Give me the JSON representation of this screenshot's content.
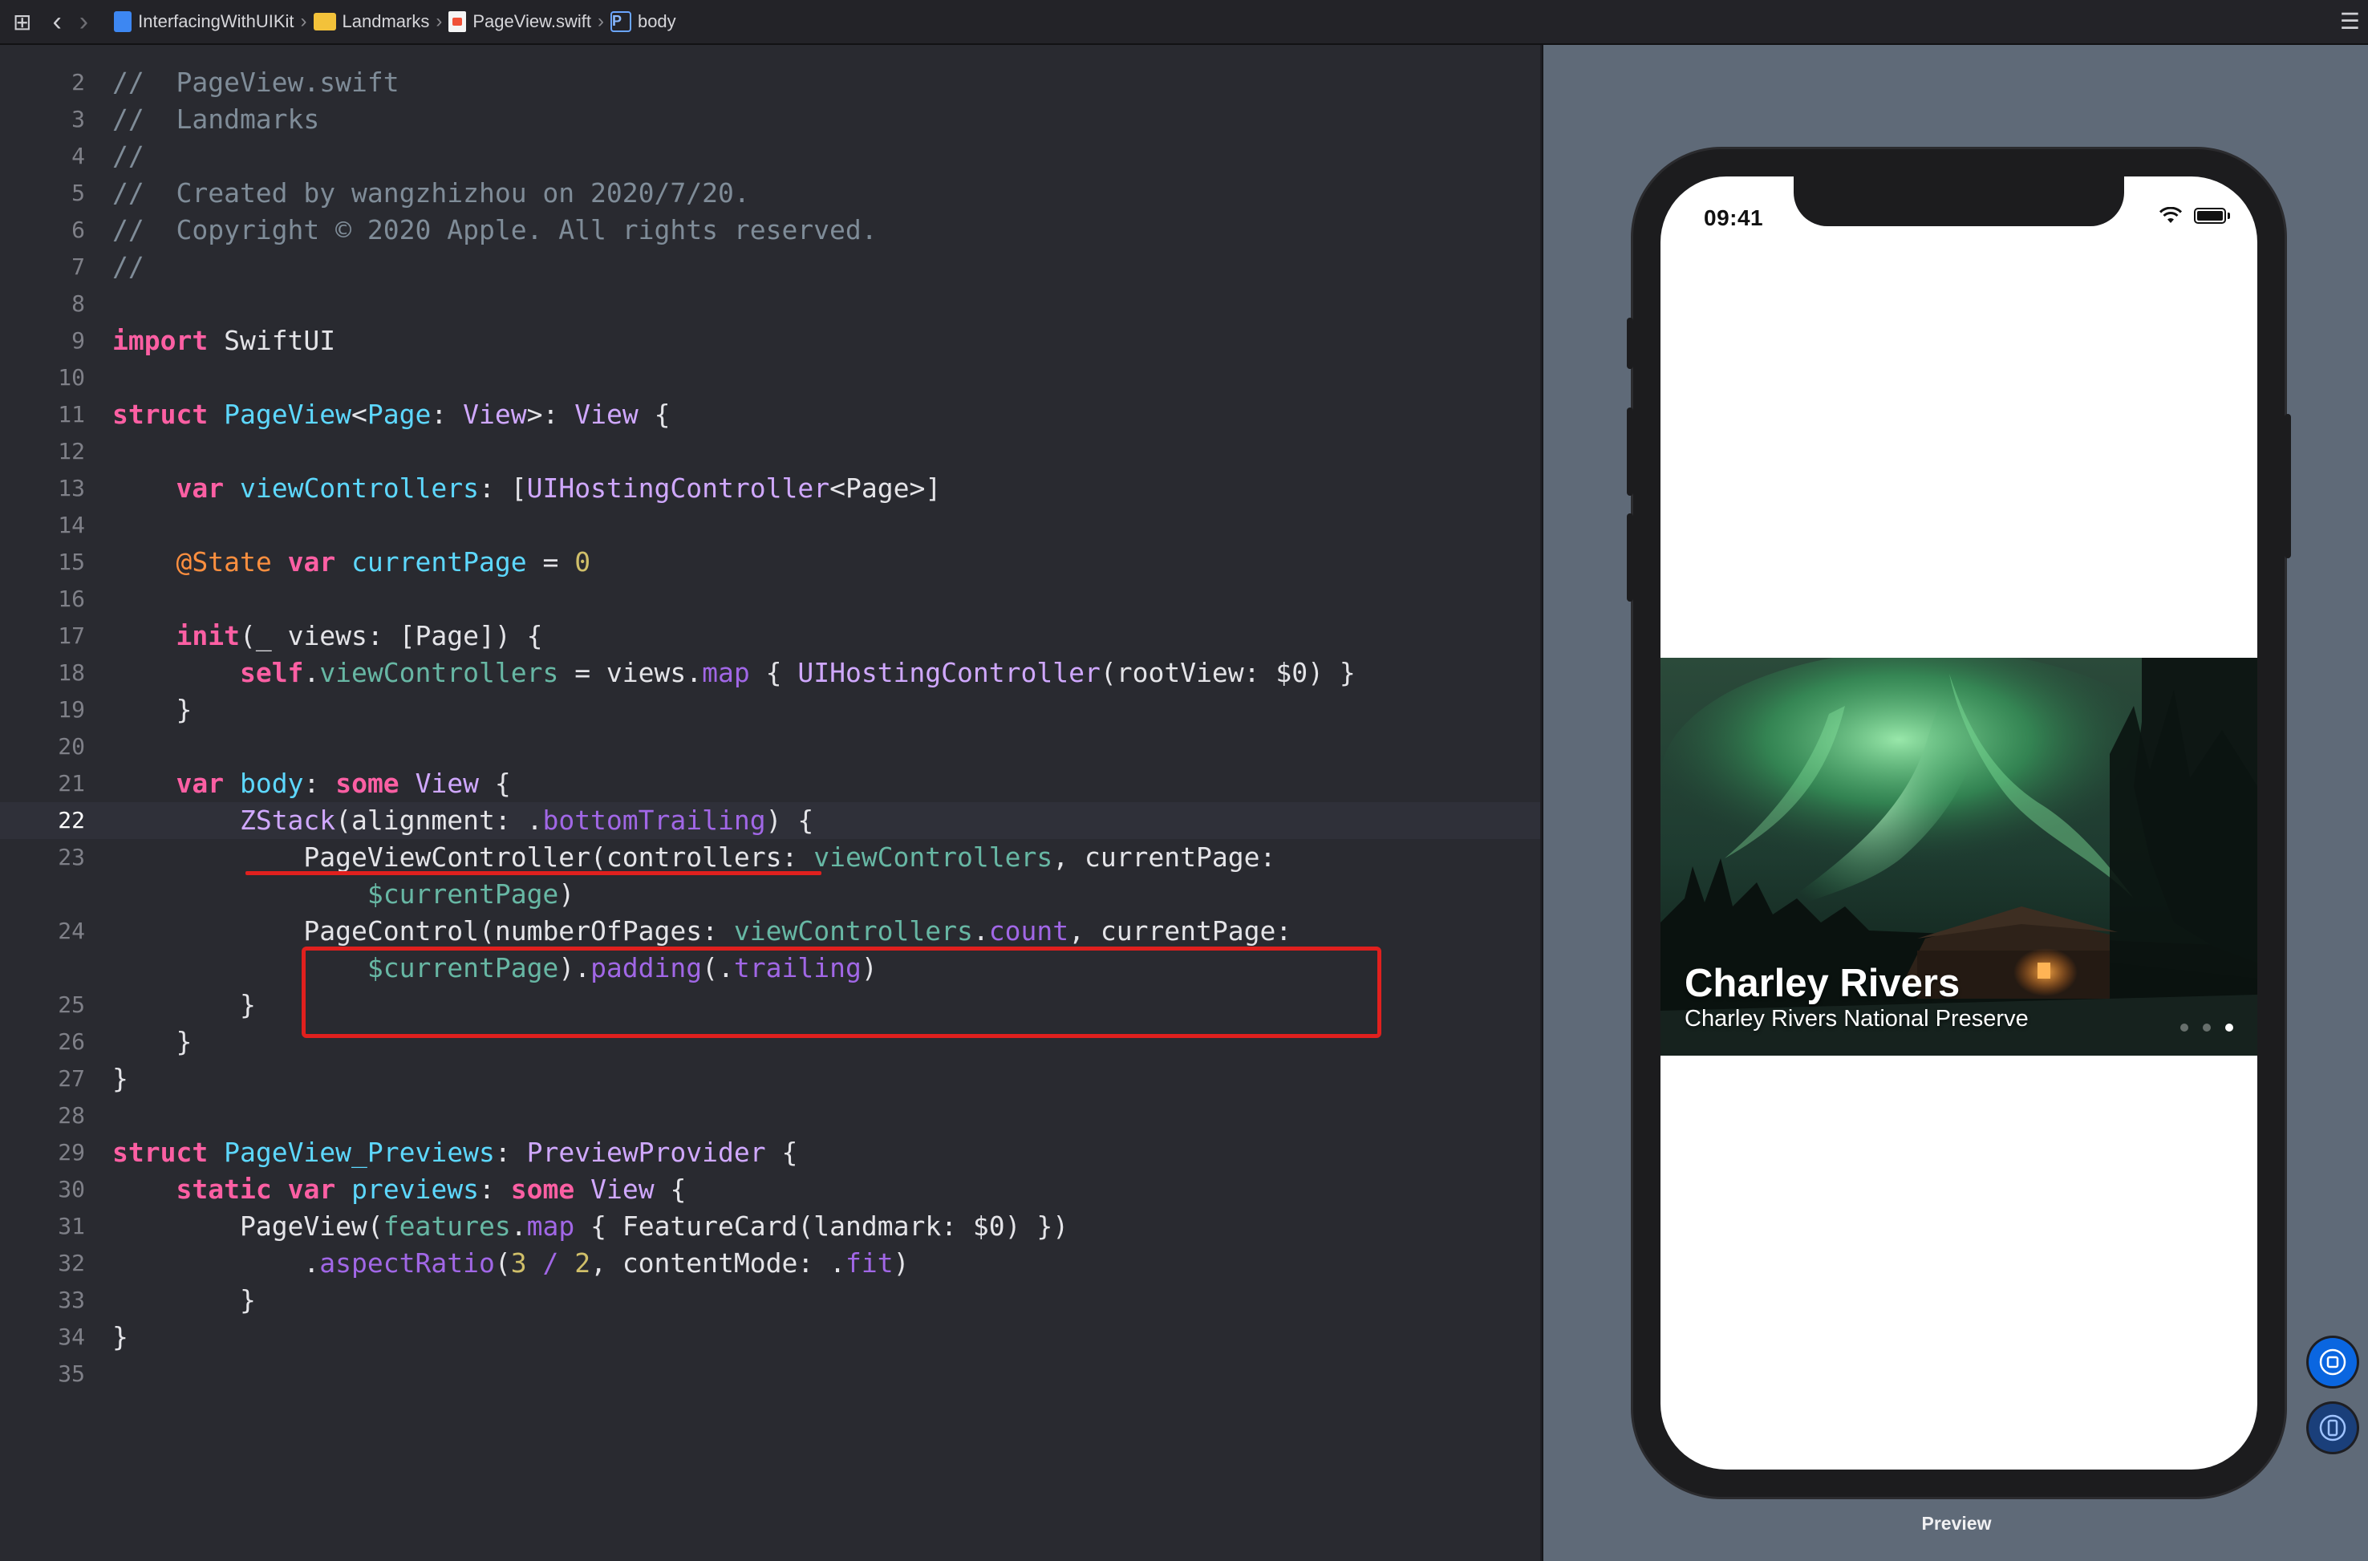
{
  "jumpbar": {
    "crumbs": [
      {
        "label": "InterfacingWithUIKit",
        "icon": "xcode-project-icon"
      },
      {
        "label": "Landmarks",
        "icon": "folder-icon"
      },
      {
        "label": "PageView.swift",
        "icon": "swift-file-icon"
      },
      {
        "label": "body",
        "icon": "property-icon",
        "badge": "P"
      }
    ]
  },
  "editor": {
    "active_line": "22",
    "lines": [
      {
        "n": "2"
      },
      {
        "n": "3"
      },
      {
        "n": "4"
      },
      {
        "n": "5"
      },
      {
        "n": "6"
      },
      {
        "n": "7"
      },
      {
        "n": "8"
      },
      {
        "n": "9"
      },
      {
        "n": "10"
      },
      {
        "n": "11"
      },
      {
        "n": "12"
      },
      {
        "n": "13"
      },
      {
        "n": "14"
      },
      {
        "n": "15"
      },
      {
        "n": "16"
      },
      {
        "n": "17"
      },
      {
        "n": "18"
      },
      {
        "n": "19"
      },
      {
        "n": "20"
      },
      {
        "n": "21"
      },
      {
        "n": "22"
      },
      {
        "n": "23"
      },
      {
        "n": ""
      },
      {
        "n": "24"
      },
      {
        "n": ""
      },
      {
        "n": "25"
      },
      {
        "n": "26"
      },
      {
        "n": "27"
      },
      {
        "n": "28"
      },
      {
        "n": "29"
      },
      {
        "n": "30"
      },
      {
        "n": "31"
      },
      {
        "n": "32"
      },
      {
        "n": "33"
      },
      {
        "n": "34"
      },
      {
        "n": "35"
      }
    ],
    "code": {
      "l2": "//  PageView.swift",
      "l3": "//  Landmarks",
      "l4": "//",
      "l5": "//  Created by wangzhizhou on 2020/7/20.",
      "l6": "//  Copyright © 2020 Apple. All rights reserved.",
      "l7": "//",
      "kw_import": "import",
      "t_swiftui": " SwiftUI",
      "kw_struct": "struct",
      "t_pageview": "PageView",
      "t_lt": "<",
      "t_page": "Page",
      "t_colon1": ": ",
      "t_view1": "View",
      "t_gt": ">: ",
      "t_view2": "View",
      "t_brace1": " {",
      "kw_var1": "var",
      "t_viewcontrollers": "viewControllers",
      "t_colon2": ": [",
      "t_uihc": "UIHostingController",
      "t_lt2": "<",
      "t_page2": "Page",
      "t_end13": ">]",
      "attr_state": "@State",
      "kw_var2": "var",
      "t_currentpage": "currentPage",
      "t_eq": " = ",
      "num_0": "0",
      "kw_init": "init",
      "t_init_args": "(_ views: [Page]) {",
      "kw_self": "self",
      "t_dot1": ".",
      "t_vc2": "viewControllers",
      "t_eq2": " = views.",
      "t_map": "map",
      "t_brace2": " { ",
      "t_uihc2": "UIHostingController",
      "t_root": "(rootView: $0) }",
      "t_close19": "}",
      "kw_var3": "var",
      "t_body": "body",
      "t_colon3": ": ",
      "kw_some": "some",
      "t_view3": "View",
      "t_brace3": " {",
      "t_zstack": "ZStack",
      "t_align": "(alignment: .",
      "t_bottomtrailing": "bottomTrailing",
      "t_brace4": ") {",
      "t_pvc": "PageViewController",
      "t_ctrl": "(controllers: ",
      "t_vc3": "viewControllers",
      "t_cp": ", currentPage:",
      "t_cpbind": "$currentPage",
      "t_paren1": ")",
      "t_pc": "PageControl",
      "t_nop": "(numberOfPages: ",
      "t_vc4": "viewControllers",
      "t_dot2": ".",
      "t_count": "count",
      "t_cp2": ", currentPage:",
      "t_cpbind2": "$currentPage",
      "t_paren2": ").",
      "t_padding": "padding",
      "t_dottr": "(.",
      "t_trailing": "trailing",
      "t_paren3": ")",
      "t_close25": "}",
      "t_close26": "}",
      "t_close27": "}",
      "kw_struct2": "struct",
      "t_pvprev": "PageView_Previews",
      "t_colon4": ": ",
      "t_pp": "PreviewProvider",
      "t_brace5": " {",
      "kw_static": "static",
      "kw_var4": "var",
      "t_previews": "previews",
      "t_colon5": ": ",
      "kw_some2": "some",
      "t_view4": "View",
      "t_brace6": " {",
      "t_pv2": "PageView",
      "t_po": "(",
      "t_features": "features",
      "t_dot3": ".",
      "t_map2": "map",
      "t_brace7": " { ",
      "t_fc": "FeatureCard",
      "t_lm": "(landmark: $0) })",
      "t_dot4": ".",
      "t_ar": "aspectRatio",
      "t_ar_open": "(",
      "num_3": "3",
      "t_slash": " / ",
      "num_2": "2",
      "t_cm": ", contentMode: .",
      "t_fit": "fit",
      "t_ar_close": ")",
      "t_close33": "}",
      "t_close34": "}"
    }
  },
  "preview": {
    "label": "Preview",
    "status_time": "09:41",
    "feature": {
      "title": "Charley Rivers",
      "subtitle": "Charley Rivers National Preserve",
      "page_count": 3,
      "current_page": 3
    }
  },
  "colors": {
    "editor_bg": "#292a30",
    "keyword": "#fc5fa3",
    "type": "#d0a8ff",
    "comment": "#7f8c98",
    "annotation_red": "#e0201e",
    "preview_bg": "#5f6a78"
  }
}
